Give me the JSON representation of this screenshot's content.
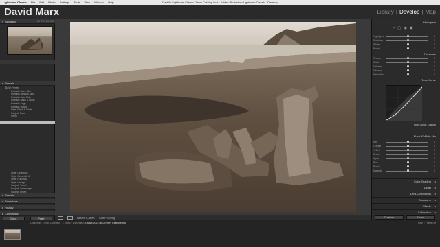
{
  "mac_menu": {
    "items": [
      "Lightroom Classic",
      "File",
      "Edit",
      "Photo",
      "Settings",
      "Tools",
      "View",
      "Window",
      "Help"
    ],
    "window_title": "David's Lightroom Classic Demo Catalog.lrcat - Adobe Photoshop Lightroom Classic - Develop"
  },
  "identity_plate": "David Marx",
  "modules": [
    "Library",
    "Develop",
    "Map"
  ],
  "active_module": "Develop",
  "left_panel": {
    "navigator_title": "Navigator",
    "navigator_modes": [
      "Fit",
      "Fill",
      "1:1",
      "3:1"
    ],
    "presets_title": "Presets",
    "preset_group": "B&W Presets",
    "preset_items": [
      "Portraits Deep Skin",
      "Portraits Medium Skin",
      "Portraits Light Skin",
      "Portraits Black & White",
      "Portraits Edgy",
      "Portraits Group",
      "Style: Black & White",
      "Subject: Food",
      "Sepia",
      "",
      "",
      "",
      "",
      "",
      "",
      "",
      "",
      "",
      "",
      "",
      "",
      "",
      "",
      "",
      "",
      "",
      "Style: Cinematic",
      "Style: Cinematic II",
      "Style: Futuristic",
      "Style: Vintage",
      "Subject: Travel",
      "Subject: Landscape",
      "Subject: Urban",
      "Subject: Lifestyle"
    ],
    "selected_index": 10,
    "collapsed": [
      "Presets",
      "Snapshots",
      "History",
      "Collections"
    ],
    "copy_button": "Copy...",
    "paste_button": "Paste"
  },
  "toolbar": {
    "items": [
      "Before & After:",
      "Soft Proofing"
    ]
  },
  "right_panel": {
    "histogram_title": "Histogram",
    "tone_sliders": [
      {
        "label": "Highlights",
        "value": "0"
      },
      {
        "label": "Shadows",
        "value": "0"
      },
      {
        "label": "Whites",
        "value": "0"
      },
      {
        "label": "Blacks",
        "value": "0"
      }
    ],
    "presence_title": "Presence",
    "presence_sliders": [
      {
        "label": "Texture",
        "value": "0"
      },
      {
        "label": "Clarity",
        "value": "0"
      },
      {
        "label": "Dehaze",
        "value": "0"
      },
      {
        "label": "Vibrance",
        "value": "0"
      },
      {
        "label": "Saturation",
        "value": "0"
      }
    ],
    "tone_curve_title": "Tone Curve",
    "point_curve_label": "Point Curve: Custom",
    "bw_title": "Black & White Mix",
    "bw_sliders": [
      {
        "label": "Red",
        "value": "0"
      },
      {
        "label": "Orange",
        "value": "0"
      },
      {
        "label": "Yellow",
        "value": "0"
      },
      {
        "label": "Green",
        "value": "0"
      },
      {
        "label": "Aqua",
        "value": "0"
      },
      {
        "label": "Blue",
        "value": "0"
      },
      {
        "label": "Purple",
        "value": "0"
      },
      {
        "label": "Magenta",
        "value": "0"
      }
    ],
    "collapsed": [
      "Color Grading",
      "Detail",
      "Lens Corrections",
      "Transform",
      "Effects",
      "Calibration"
    ],
    "previous_button": "Previous",
    "reset_button": "Reset"
  },
  "filmstrip": {
    "collection": "Collection : Demo Collection",
    "path": "1 photo / 1 selected /",
    "filename": "DMarx 2022-06-09 HMV Example.dng",
    "filter_label": "Filter :",
    "filter_value": "Filters Off"
  },
  "colors": {
    "accent": "#ffffff",
    "panel_bg": "#2b2b2b",
    "center_bg": "#3a3a3a",
    "sepia_sand": "#5e4f40",
    "sepia_sky": "#d6cec3"
  }
}
